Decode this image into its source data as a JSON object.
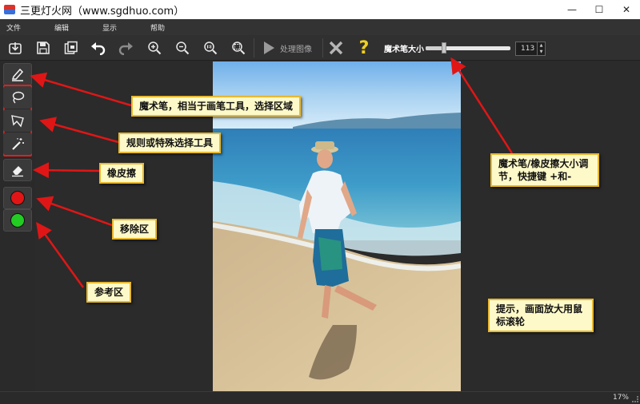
{
  "window": {
    "title": "三更灯火网（www.sgdhuo.com）",
    "minimize": "—",
    "maximize": "☐",
    "close": "✕"
  },
  "menu": {
    "items": [
      "文件",
      "编辑",
      "显示",
      "帮助"
    ]
  },
  "toolbar": {
    "buttons": [
      "import-icon",
      "save-icon",
      "save-copy-icon",
      "undo-icon",
      "redo-icon",
      "zoom-in-icon",
      "zoom-out-icon",
      "actual-size-icon",
      "fit-window-icon",
      "play-icon",
      "cancel-icon",
      "help-icon"
    ],
    "process_label": "处理图像",
    "help_glyph": "?",
    "brush_size_label": "魔术笔大小",
    "brush_size_value": "113",
    "brush_size_fraction": 0.22,
    "spin_up": "▲",
    "spin_down": "▼"
  },
  "tools": {
    "items": [
      "magic-pen-icon",
      "lasso-icon",
      "polygon-lasso-icon",
      "magic-wand-icon",
      "eraser-icon",
      "remove-area-icon",
      "keep-area-icon"
    ],
    "remove_color": "#e01616",
    "keep_color": "#22cc22"
  },
  "annotations": {
    "magic_pen": "魔术笔，相当于画笔工具，选择区域",
    "selection_tools": "规则或特殊选择工具",
    "eraser": "橡皮擦",
    "remove_area": "移除区",
    "reference_area": "参考区",
    "brush_size": "魔术笔/橡皮擦大小调节，快捷键 +和-",
    "tip": "提示，画面放大用鼠标滚轮"
  },
  "status": {
    "zoom": "17%"
  },
  "colors": {
    "annotation_bg": "#fdf9c8",
    "annotation_border": "#e8b830",
    "arrow": "#e01616"
  }
}
